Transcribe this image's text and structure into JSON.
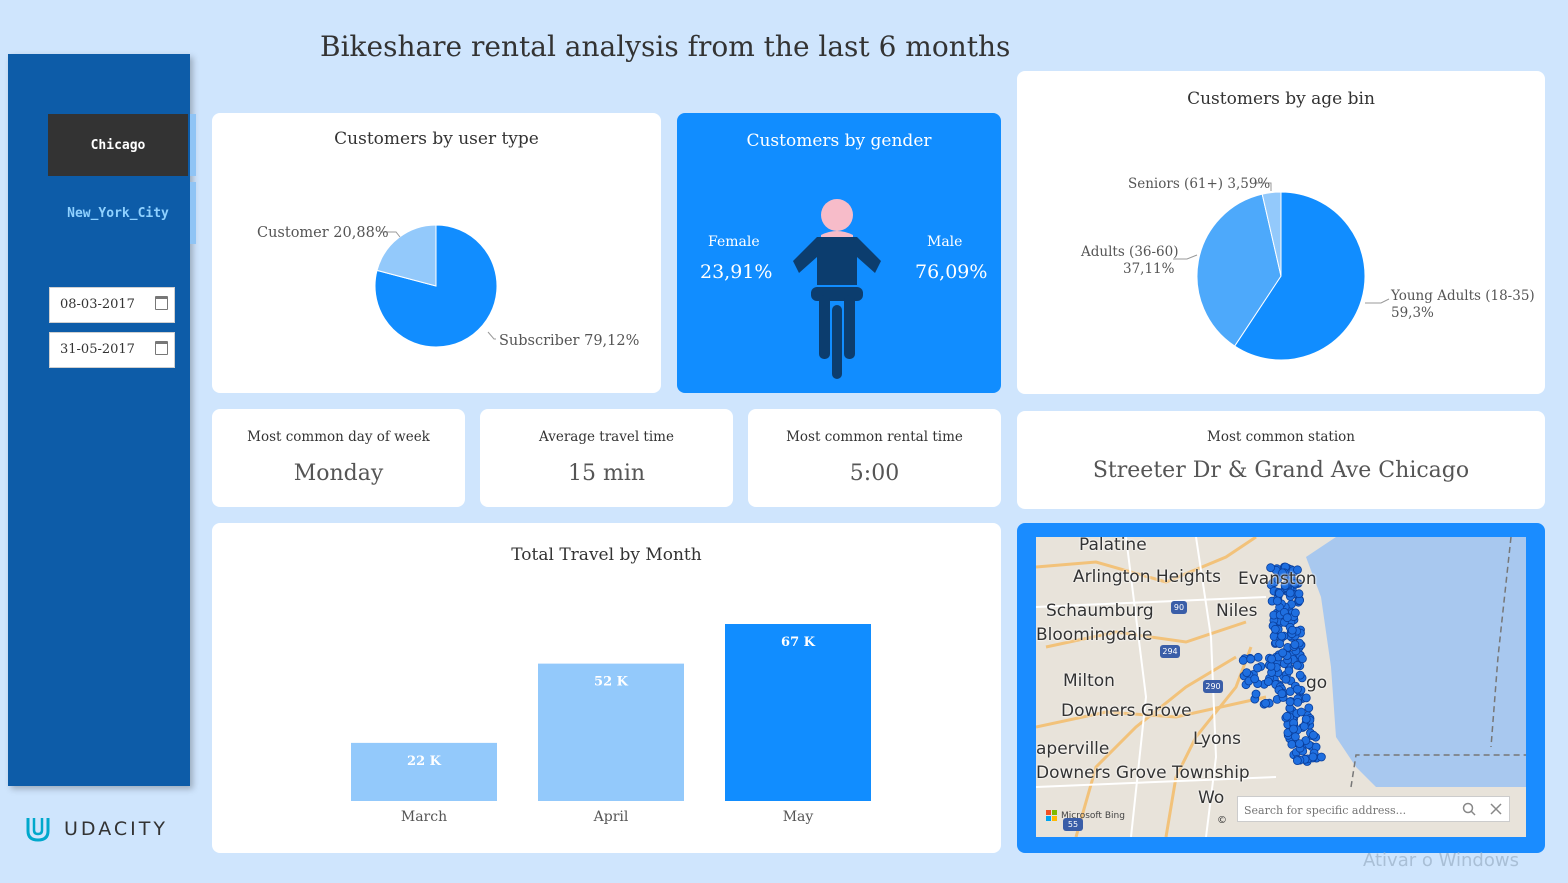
{
  "page_title": "Bikeshare rental analysis from the last 6 months",
  "sidebar": {
    "cities": [
      {
        "label": "Chicago",
        "selected": true
      },
      {
        "label": "New_York_City",
        "selected": false
      }
    ],
    "start_date": "08-03-2017",
    "end_date": "31-05-2017",
    "logo_text": "UDACITY"
  },
  "user_type": {
    "title": "Customers by user type",
    "labels": [
      "Customer 20,88%",
      "Subscriber 79,12%"
    ],
    "chart_data": {
      "type": "pie",
      "slices": [
        {
          "name": "Customer",
          "value": 20.88,
          "color": "#93c9fb"
        },
        {
          "name": "Subscriber",
          "value": 79.12,
          "color": "#118dff"
        }
      ]
    }
  },
  "gender": {
    "title": "Customers by gender",
    "female_label": "Female",
    "female_value": "23,91%",
    "male_label": "Male",
    "male_value": "76,09%",
    "colors": {
      "background": "#118dff",
      "head": "#f7bcc9",
      "body": "#0c3d6e"
    }
  },
  "age_bin": {
    "title": "Customers by age bin",
    "labels": {
      "seniors": "Seniors (61+) 3,59%",
      "adults_name": "Adults (36-60)",
      "adults_value": "37,11%",
      "young_name": "Young Adults (18-35)",
      "young_value": "59,3%"
    },
    "chart_data": {
      "type": "pie",
      "slices": [
        {
          "name": "Young Adults (18-35)",
          "value": 59.3,
          "color": "#118dff"
        },
        {
          "name": "Adults (36-60)",
          "value": 37.11,
          "color": "#4da9fb"
        },
        {
          "name": "Seniors (61+)",
          "value": 3.59,
          "color": "#93c9fb"
        }
      ]
    }
  },
  "kpis": [
    {
      "label": "Most common day of week",
      "value": "Monday"
    },
    {
      "label": "Average travel time",
      "value": "15 min"
    },
    {
      "label": "Most common rental time",
      "value": "5:00"
    }
  ],
  "station": {
    "label": "Most common station",
    "value": "Streeter Dr & Grand Ave Chicago"
  },
  "travel_by_month": {
    "title": "Total Travel by Month",
    "chart_data": {
      "type": "bar",
      "categories": [
        "March",
        "April",
        "May"
      ],
      "values": [
        22,
        52,
        67
      ],
      "data_labels": [
        "22 K",
        "52 K",
        "67 K"
      ],
      "colors": [
        "#93c9fb",
        "#93c9fb",
        "#118dff"
      ],
      "ylim": [
        0,
        67
      ]
    }
  },
  "map": {
    "places": [
      "Palatine",
      "Arlington Heights",
      "Evanston",
      "Schaumburg",
      "Niles",
      "Bloomingdale",
      "Milton",
      "Downers Grove",
      "Lyons",
      "aperville",
      "Downers Grove Township",
      "Wo",
      "go"
    ],
    "highway_shields": [
      "90",
      "294",
      "290",
      "55"
    ],
    "attribution": "Microsoft Bing",
    "search_placeholder": "Search for specific address...",
    "copyright": "©"
  },
  "watermark": "Ativar o Windows"
}
